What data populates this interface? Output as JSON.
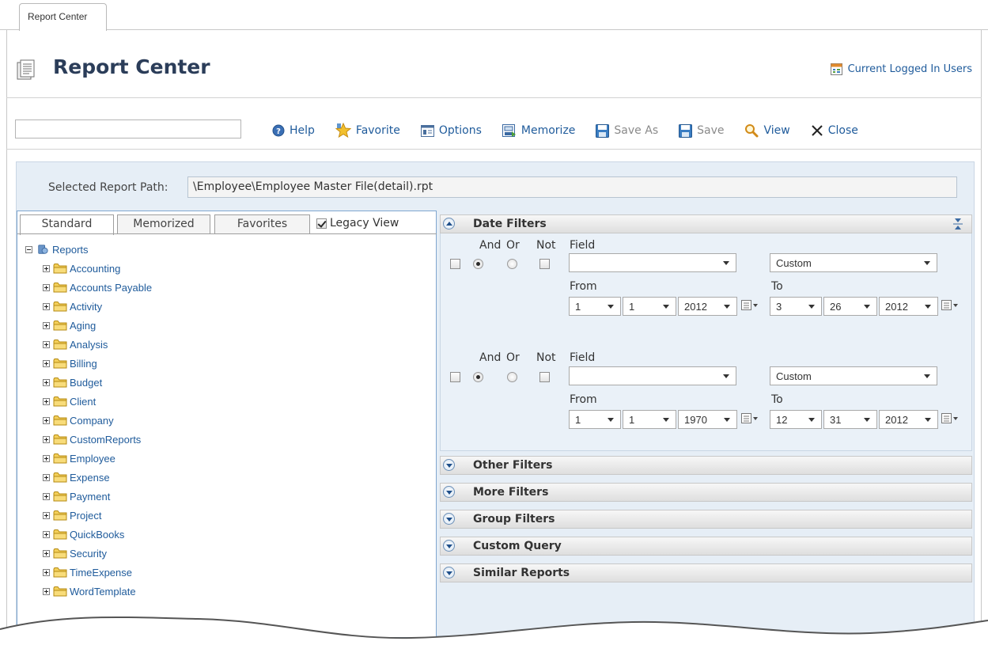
{
  "tab": {
    "label": "Report Center"
  },
  "header": {
    "title": "Report Center",
    "current_users_link": "Current Logged In Users"
  },
  "toolbar": {
    "search": {
      "value": "",
      "placeholder": ""
    },
    "buttons": [
      {
        "label": "Help",
        "icon": "help-icon",
        "enabled": true
      },
      {
        "label": "Favorite",
        "icon": "star-icon",
        "enabled": true
      },
      {
        "label": "Options",
        "icon": "options-icon",
        "enabled": true
      },
      {
        "label": "Memorize",
        "icon": "memorize-icon",
        "enabled": true
      },
      {
        "label": "Save As",
        "icon": "save-as-icon",
        "enabled": false
      },
      {
        "label": "Save",
        "icon": "save-icon",
        "enabled": false
      },
      {
        "label": "View",
        "icon": "magnifier-icon",
        "enabled": true
      },
      {
        "label": "Close",
        "icon": "close-icon",
        "enabled": true
      }
    ]
  },
  "report_path": {
    "label": "Selected Report Path:",
    "value": "\\Employee\\Employee Master File(detail).rpt"
  },
  "tree_tabs": {
    "tabs": [
      {
        "label": "Standard"
      },
      {
        "label": "Memorized"
      },
      {
        "label": "Favorites"
      }
    ],
    "active": "Standard",
    "legacy_view": {
      "label": "Legacy View",
      "checked": true
    }
  },
  "tree": {
    "root": "Reports",
    "folders": [
      "Accounting",
      "Accounts Payable",
      "Activity",
      "Aging",
      "Analysis",
      "Billing",
      "Budget",
      "Client",
      "Company",
      "CustomReports",
      "Employee",
      "Expense",
      "Payment",
      "Project",
      "QuickBooks",
      "Security",
      "TimeExpense",
      "WordTemplate"
    ]
  },
  "date_filters": {
    "title": "Date Filters",
    "col_labels": {
      "and": "And",
      "or": "Or",
      "not": "Not",
      "field": "Field",
      "from": "From",
      "to": "To"
    },
    "rows": [
      {
        "field": "",
        "range": "Custom",
        "from": {
          "month": "1",
          "day": "1",
          "year": "2012"
        },
        "to": {
          "month": "3",
          "day": "26",
          "year": "2012"
        }
      },
      {
        "field": "",
        "range": "Custom",
        "from": {
          "month": "1",
          "day": "1",
          "year": "1970"
        },
        "to": {
          "month": "12",
          "day": "31",
          "year": "2012"
        }
      }
    ]
  },
  "sections": [
    "Other Filters",
    "More Filters",
    "Group Filters",
    "Custom Query",
    "Similar Reports"
  ],
  "colors": {
    "link": "#1f5b9b",
    "title": "#2b3d59",
    "panel_bg": "#e6eef6",
    "disabled": "#8a8a8a"
  }
}
